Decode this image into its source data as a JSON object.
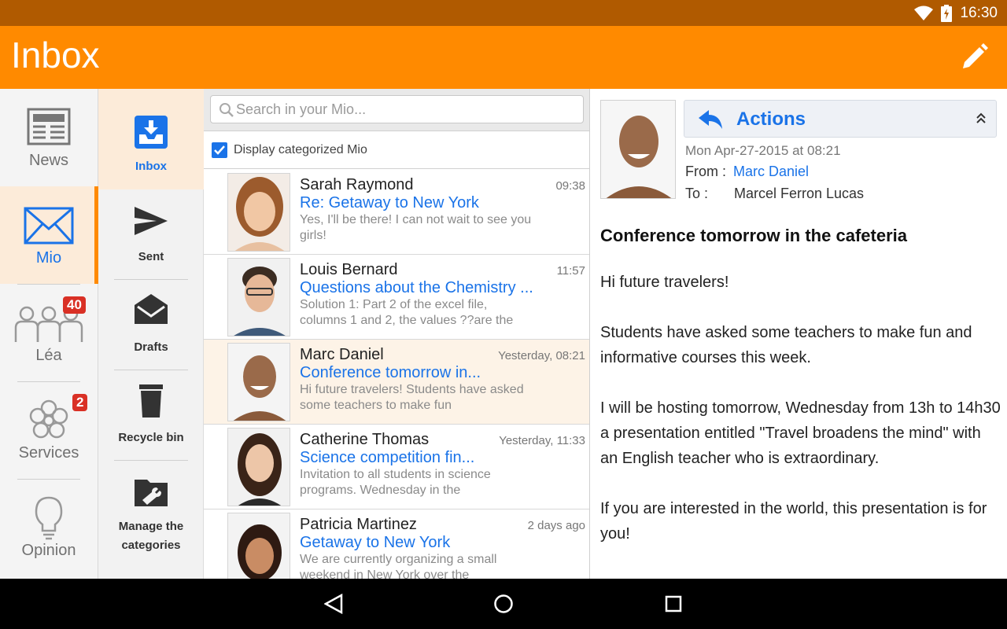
{
  "status_bar": {
    "time": "16:30"
  },
  "app_bar": {
    "title": "Inbox"
  },
  "rail": {
    "items": [
      {
        "label": "News",
        "icon": "newspaper-icon"
      },
      {
        "label": "Mio",
        "icon": "envelope-icon",
        "active": true
      },
      {
        "label": "Léa",
        "icon": "people-icon",
        "badge": "40"
      },
      {
        "label": "Services",
        "icon": "flower-icon",
        "badge": "2"
      },
      {
        "label": "Opinion",
        "icon": "lightbulb-icon"
      }
    ]
  },
  "folders": {
    "items": [
      {
        "label": "Inbox",
        "icon": "inbox-tray-icon",
        "active": true
      },
      {
        "label": "Sent",
        "icon": "paper-plane-icon"
      },
      {
        "label": "Drafts",
        "icon": "open-envelope-icon"
      },
      {
        "label": "Recycle bin",
        "icon": "trash-icon"
      },
      {
        "label_line1": "Manage the",
        "label_line2": "categories",
        "icon": "folder-wrench-icon"
      }
    ]
  },
  "list": {
    "search_placeholder": "Search in your Mio...",
    "categorized_label": "Display categorized Mio",
    "categorized_checked": true,
    "messages": [
      {
        "sender": "Sarah Raymond",
        "time": "09:38",
        "subject": "Re: Getaway to New York",
        "preview": "Yes, I'll be there! I can not wait to see you girls!"
      },
      {
        "sender": "Louis Bernard",
        "time": "11:57",
        "subject": "Questions about the Chemistry ...",
        "preview": "Solution 1: Part 2 of the excel file, columns 1 and 2, the values ??are the"
      },
      {
        "sender": "Marc Daniel",
        "time": "Yesterday, 08:21",
        "subject": "Conference tomorrow in...",
        "preview": "Hi future travelers! Students have asked some teachers to make fun",
        "selected": true
      },
      {
        "sender": "Catherine Thomas",
        "time": "Yesterday, 11:33",
        "subject": "Science competition fin...",
        "preview": "Invitation to all students in science programs. Wednesday in the"
      },
      {
        "sender": "Patricia Martinez",
        "time": "2 days ago",
        "subject": "Getaway to New York",
        "preview": "We are currently organizing a small weekend in New York over the"
      }
    ]
  },
  "reader": {
    "actions_label": "Actions",
    "date": "Mon Apr-27-2015 at 08:21",
    "from_label": "From :",
    "from_value": "Marc Daniel",
    "to_label": "To :",
    "to_value": "Marcel Ferron Lucas",
    "title": "Conference tomorrow in the cafeteria",
    "paragraphs": [
      "Hi future travelers!",
      "Students have asked some teachers to make fun and informative courses this week.",
      "I will be hosting tomorrow, Wednesday from 13h to 14h30 a presentation entitled \"Travel broadens the mind\" with an English teacher who is extraordinary.",
      "If you are interested in the world, this presentation is for you!"
    ]
  },
  "colors": {
    "status_bar": "#b05a00",
    "app_bar": "#ff8a00",
    "accent": "#1a73e8",
    "selected_bg": "#fcebd9",
    "badge": "#d93025"
  }
}
